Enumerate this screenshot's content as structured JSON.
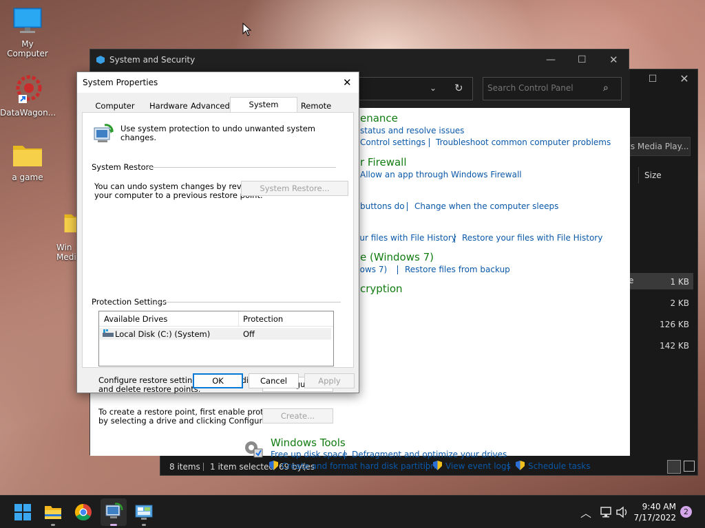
{
  "desktop": {
    "icons": [
      {
        "label": "My Computer",
        "icon": "monitor-icon"
      },
      {
        "label": "DataWagon...",
        "icon": "datawagon-shortcut-icon"
      },
      {
        "label": "a game",
        "icon": "folder-icon"
      },
      {
        "label": "Win Medi",
        "icon": "folder-icon"
      }
    ]
  },
  "explorer_window": {
    "column_partial": "ws Media Play...",
    "size_header": "Size",
    "sizes": [
      "1 KB",
      "2 KB",
      "126 KB",
      "142 KB"
    ],
    "partial_letter": "e",
    "status": {
      "items": "8 items",
      "selected": "1 item selected",
      "bytes": "69 bytes"
    }
  },
  "control_panel": {
    "title": "System and Security",
    "search_placeholder": "Search Control Panel",
    "sections": [
      {
        "heading": "enance",
        "links": [
          "status and resolve issues"
        ],
        "links2": [
          "Control settings",
          "Troubleshoot common computer problems"
        ]
      },
      {
        "heading": "r Firewall",
        "links": [
          "Allow an app through Windows Firewall"
        ]
      },
      {
        "links": [
          "buttons do",
          "Change when the computer sleeps"
        ]
      },
      {
        "links": [
          "our files with File History",
          "Restore your files with File History"
        ]
      },
      {
        "heading": "e (Windows 7)",
        "links": [
          "dows 7)",
          "Restore files from backup"
        ]
      },
      {
        "heading": "cryption"
      }
    ],
    "tools": {
      "heading": "Windows Tools",
      "links": [
        "Free up disk space",
        "Defragment and optimize your drives"
      ],
      "links2": [
        "Create and format hard disk partitions",
        "View event logs",
        "Schedule tasks"
      ]
    }
  },
  "system_properties": {
    "title": "System Properties",
    "tabs": [
      "Computer Name",
      "Hardware",
      "Advanced",
      "System Protection",
      "Remote"
    ],
    "active_tab": "System Protection",
    "intro": "Use system protection to undo unwanted system changes.",
    "restore_group": "System Restore",
    "restore_text_1": "You can undo system changes by reverting",
    "restore_text_2": "your computer to a previous restore point.",
    "restore_button": "System Restore...",
    "protection_group": "Protection Settings",
    "columns": [
      "Available Drives",
      "Protection"
    ],
    "drives": [
      {
        "name": "Local Disk (C:) (System)",
        "protection": "Off"
      }
    ],
    "configure_text_1": "Configure restore settings, manage disk space,",
    "configure_text_2": "and delete restore points.",
    "configure_button": "Configure...",
    "create_text_1": "To create a restore point, first enable protection",
    "create_text_2": "by selecting a drive and clicking Configure.",
    "create_button": "Create...",
    "ok": "OK",
    "cancel": "Cancel",
    "apply": "Apply"
  },
  "taskbar": {
    "time": "9:40 AM",
    "date": "7/17/2022",
    "notification_count": "2"
  },
  "colors": {
    "link": "#0a58a8",
    "heading": "#107c10",
    "accent": "#0078d7"
  }
}
